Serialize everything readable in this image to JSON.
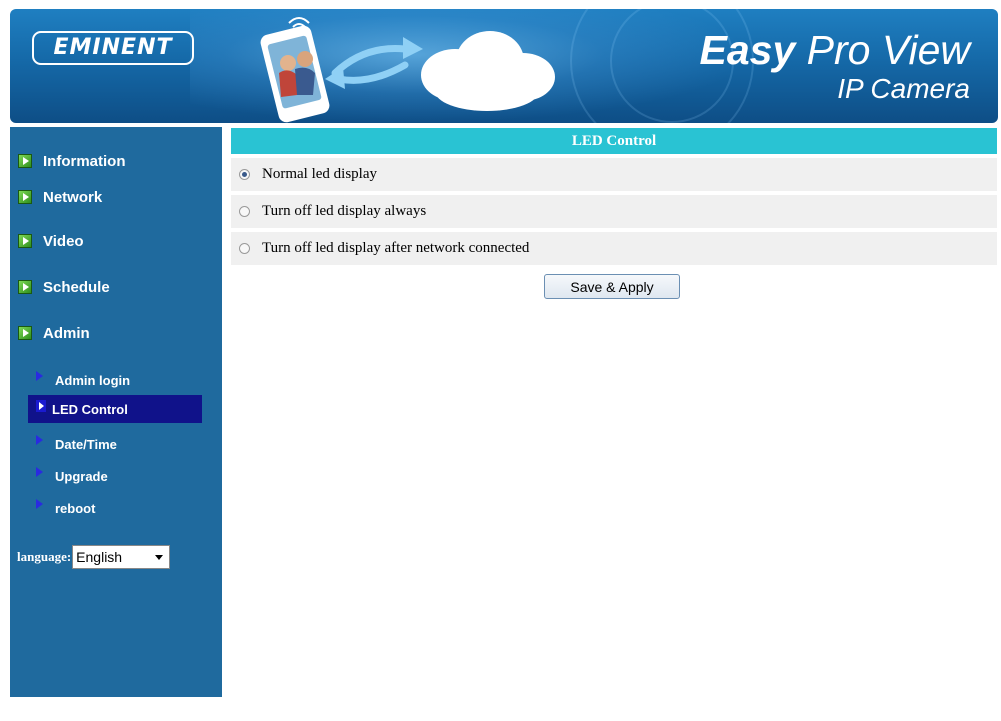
{
  "header": {
    "brand_logo": "EMINENT",
    "title_bold": "Easy",
    "title_light": " Pro View",
    "subtitle": "IP Camera",
    "art_icons": [
      "phone-photo-icon",
      "sync-arrows-icon",
      "cloud-icon"
    ]
  },
  "sidebar": {
    "items": [
      {
        "label": "Information",
        "icon": "green-arrow-icon"
      },
      {
        "label": "Network",
        "icon": "green-arrow-icon"
      },
      {
        "label": "Video",
        "icon": "green-arrow-icon"
      },
      {
        "label": "Schedule",
        "icon": "green-arrow-icon"
      },
      {
        "label": "Admin",
        "icon": "green-arrow-icon"
      }
    ],
    "sub_items": [
      {
        "label": "Admin login",
        "active": false
      },
      {
        "label": "LED Control",
        "active": true
      },
      {
        "label": "Date/Time",
        "active": false
      },
      {
        "label": "Upgrade",
        "active": false
      },
      {
        "label": "reboot",
        "active": false
      }
    ],
    "language_label": "language:",
    "language_value": "English"
  },
  "main": {
    "panel_title": "LED Control",
    "options": [
      {
        "label": "Normal led display",
        "checked": true
      },
      {
        "label": "Turn off led display always",
        "checked": false
      },
      {
        "label": "Turn off led display after network connected",
        "checked": false
      }
    ],
    "save_button": "Save & Apply"
  },
  "colors": {
    "header_blue": "#1569a8",
    "sidebar_blue": "#1f6a9e",
    "active_sub_bg": "#10128a",
    "panel_title_bg": "#29c3d3",
    "option_row_bg": "#f0f0f0"
  }
}
